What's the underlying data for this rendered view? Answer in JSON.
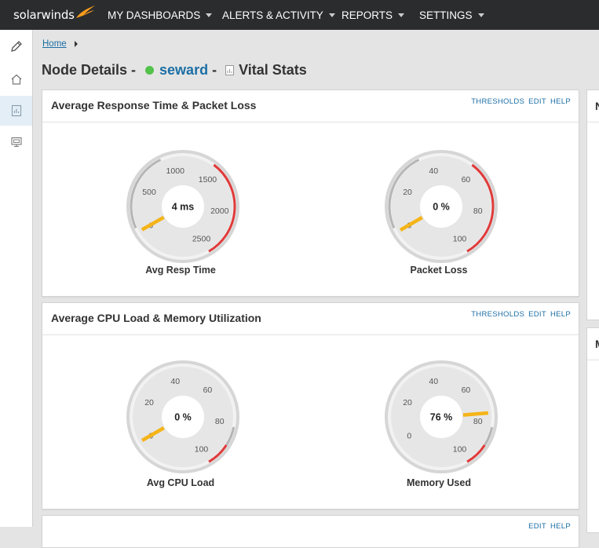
{
  "brand": {
    "name": "solarwinds",
    "accent": "#f99d1c"
  },
  "nav": {
    "items": [
      {
        "label": "MY DASHBOARDS"
      },
      {
        "label": "ALERTS & ACTIVITY"
      },
      {
        "label": "REPORTS"
      },
      {
        "label": "SETTINGS"
      }
    ]
  },
  "rail": {
    "items": [
      {
        "icon": "pencil-icon"
      },
      {
        "icon": "home-icon"
      },
      {
        "icon": "report-icon",
        "active": true
      },
      {
        "icon": "monitor-icon"
      }
    ]
  },
  "breadcrumb": {
    "home": "Home"
  },
  "page": {
    "title_prefix": "Node Details - ",
    "node_name": "seward",
    "node_status_color": "#52c24a",
    "separator": " - ",
    "view_name": "Vital Stats"
  },
  "panels": [
    {
      "title": "Average Response Time & Packet Loss",
      "links": [
        "THRESHOLDS",
        "EDIT",
        "HELP"
      ],
      "gauges": [
        {
          "label": "Avg Resp Time",
          "readout": "4 ms",
          "ticks": [
            "0",
            "500",
            "1000",
            "1500",
            "2000",
            "2500"
          ],
          "value": 4,
          "max": 2500
        },
        {
          "label": "Packet Loss",
          "readout": "0 %",
          "ticks": [
            "0",
            "20",
            "40",
            "60",
            "80",
            "100"
          ],
          "value": 0,
          "max": 100
        }
      ]
    },
    {
      "title": "Average CPU Load & Memory Utilization",
      "links": [
        "THRESHOLDS",
        "EDIT",
        "HELP"
      ],
      "gauges": [
        {
          "label": "Avg CPU Load",
          "readout": "0 %",
          "ticks": [
            "0",
            "20",
            "40",
            "60",
            "80",
            "100"
          ],
          "value": 0,
          "max": 100
        },
        {
          "label": "Memory Used",
          "readout": "76 %",
          "ticks": [
            "0",
            "20",
            "40",
            "60",
            "80",
            "100"
          ],
          "value": 76,
          "max": 100
        }
      ]
    }
  ],
  "side_panels": [
    {
      "title": "N"
    },
    {
      "title": "M"
    }
  ],
  "bottom_panel": {
    "links": [
      "EDIT",
      "HELP"
    ]
  },
  "colors": {
    "needle": "#f5b418",
    "critical": "#e03a3a",
    "normal_arc": "#b5b5b5",
    "link": "#1d6fa5"
  }
}
